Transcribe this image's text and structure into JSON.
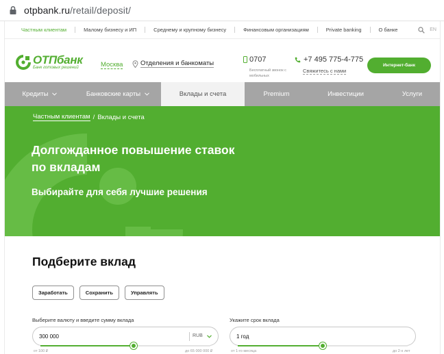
{
  "browser": {
    "url_host": "otpbank.ru",
    "url_path": "/retail/deposit/"
  },
  "segments": {
    "items": [
      "Частным клиентам",
      "Малому бизнесу и ИП",
      "Среднему и крупному бизнесу",
      "Финансовым организациям",
      "Private banking",
      "О банке"
    ],
    "active": "Частным клиентам",
    "lang": "EN"
  },
  "header": {
    "logo_name": "ОТПбанк",
    "logo_slogan": "Банк готовых решений",
    "city": "Москва",
    "branches_link": "Отделения и банкоматы",
    "phone_short": "0707",
    "phone_short_note": "Бесплатный звонок с мобильных",
    "phone_long": "+7 495 775-4-775",
    "callback_link": "Свяжитесь с нами",
    "ibank_button": "Интернет-банк"
  },
  "menu": {
    "items": [
      {
        "label": "Кредиты",
        "has_dropdown": true
      },
      {
        "label": "Банковские карты",
        "has_dropdown": true
      },
      {
        "label": "Вклады и счета",
        "has_dropdown": false,
        "active": true
      },
      {
        "label": "Premium",
        "has_dropdown": false
      },
      {
        "label": "Инвестиции",
        "has_dropdown": false
      },
      {
        "label": "Услуги",
        "has_dropdown": false
      }
    ]
  },
  "hero": {
    "breadcrumb_root": "Частным клиентам",
    "breadcrumb_separator": "/",
    "breadcrumb_current": "Вклады и счета",
    "title": "Долгожданное повышение ставок по вкладам",
    "subtitle": "Выбирайте для себя лучшие решения"
  },
  "picker": {
    "title": "Подберите вклад",
    "goal_buttons": [
      "Заработать",
      "Сохранить",
      "Управлять"
    ],
    "amount_label": "Выберите валюту и введите сумму вклада",
    "amount_value": "300 000",
    "currency": "RUB",
    "amount_min": "от 100 ₽",
    "amount_max": "до 65 000 000 ₽",
    "amount_slider_fraction": 0.55,
    "term_label": "Укажите срок вклада",
    "term_value": "1 год",
    "term_min": "от 1-го месяца",
    "term_max": "до 2-х лет",
    "term_slider_fraction": 0.5
  },
  "colors": {
    "brand_green": "#52ae30",
    "menu_gray": "#a5a5a5"
  },
  "icons": [
    "lock-icon",
    "search-icon",
    "location-pin-icon",
    "mobile-icon",
    "phone-icon",
    "chevron-down-icon"
  ]
}
